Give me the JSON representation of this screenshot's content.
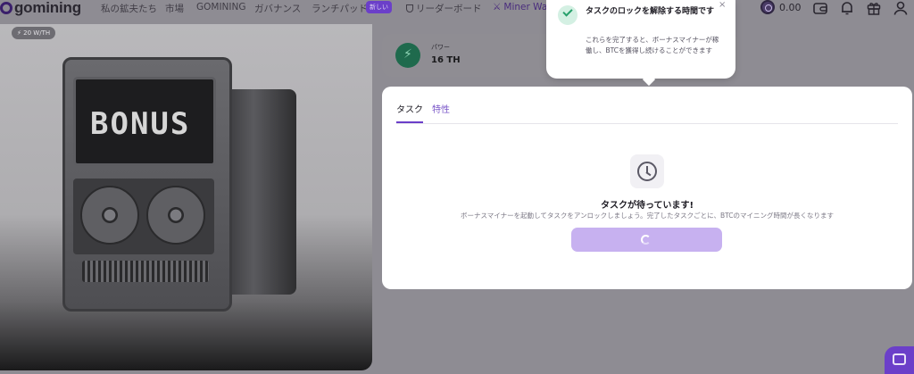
{
  "header": {
    "logo_text": "gomining",
    "nav": [
      {
        "label": "私の鉱夫たち"
      },
      {
        "label": "市場"
      },
      {
        "label": "GOMINING"
      },
      {
        "label": "ガバナンス"
      },
      {
        "label": "ランチパッド"
      },
      {
        "label": "リーダーボード"
      },
      {
        "label": "Miner Wars"
      }
    ],
    "new_badge": "新しい",
    "balance": "0.00",
    "icons": [
      "wallet-icon",
      "bell-icon",
      "gift-icon",
      "user-icon"
    ]
  },
  "hero": {
    "hashrate_pill": "20 W/TH",
    "screen_text": "BONUS"
  },
  "power": {
    "label": "パワー",
    "value": "16 TH"
  },
  "tasks_panel": {
    "tabs": [
      {
        "label": "タスク",
        "active": true
      },
      {
        "label": "特性",
        "active": false
      }
    ],
    "empty_title": "タスクが待っています!",
    "empty_desc": "ボーナスマイナーを起動してタスクをアンロックしましょう。完了したタスクごとに、BTCのマイニング時間が長くなります"
  },
  "toast": {
    "title": "タスクのロックを解除する時間です",
    "body": "これらを完了すると、ボーナスマイナーが稼働し、BTCを獲得し続けることができます",
    "close": "×"
  },
  "colors": {
    "accent": "#6b3fc9",
    "button": "#c7b1f0",
    "success": "#27a06b",
    "power_green": "#1f6a4d"
  }
}
